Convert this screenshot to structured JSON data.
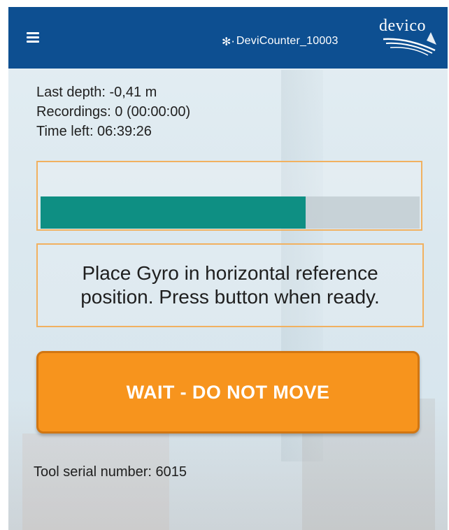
{
  "header": {
    "device_name": "DeviCounter_10003",
    "bluetooth_icon": "bluetooth-icon",
    "menu_icon": "hamburger-menu-icon",
    "logo_text": "devico",
    "background_color": "#0d4f91"
  },
  "status": {
    "last_depth": "Last depth: -0,41 m",
    "recordings": "Recordings: 0 (00:00:00)",
    "time_left": "Time left: 06:39:26"
  },
  "progress": {
    "value_percent": 70,
    "fill_color": "#0e8f83"
  },
  "message": {
    "text": "Place Gyro in horizontal reference position. Press button when ready."
  },
  "action_button": {
    "label": "WAIT - DO NOT MOVE",
    "color": "#f7941d"
  },
  "footer": {
    "tool_serial": "Tool serial number: 6015"
  }
}
